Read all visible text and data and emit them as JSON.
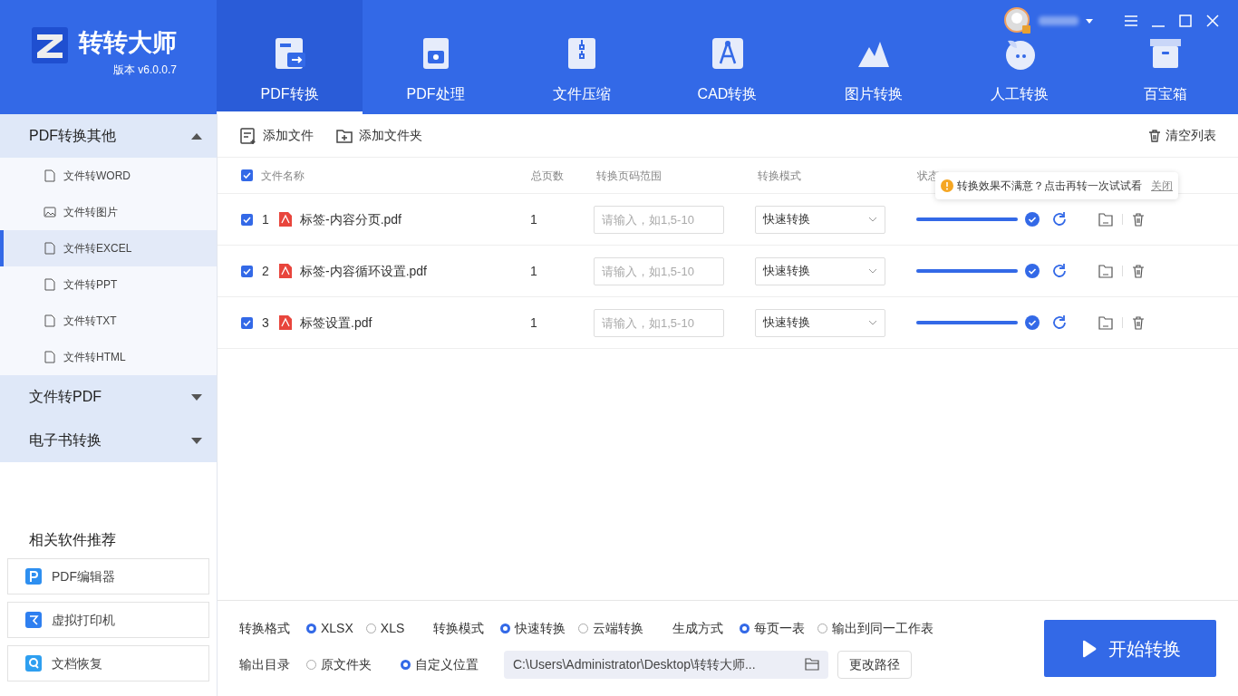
{
  "app": {
    "name": "转转大师",
    "version": "版本 v6.0.0.7"
  },
  "nav_tabs": [
    {
      "label": "PDF转换",
      "selected": true,
      "kind": "pdf"
    },
    {
      "label": "PDF处理",
      "selected": false,
      "kind": "process"
    },
    {
      "label": "文件压缩",
      "selected": false,
      "kind": "zip"
    },
    {
      "label": "CAD转换",
      "selected": false,
      "kind": "cad"
    },
    {
      "label": "图片转换",
      "selected": false,
      "kind": "image"
    },
    {
      "label": "人工转换",
      "selected": false,
      "kind": "chat"
    },
    {
      "label": "百宝箱",
      "selected": false,
      "kind": "box"
    }
  ],
  "sidebar": {
    "groups": [
      {
        "label": "PDF转换其他",
        "expanded": true,
        "items": [
          {
            "label": "文件转WORD",
            "selected": false,
            "kind": "document"
          },
          {
            "label": "文件转图片",
            "selected": false,
            "kind": "image"
          },
          {
            "label": "文件转EXCEL",
            "selected": true,
            "kind": "document"
          },
          {
            "label": "文件转PPT",
            "selected": false,
            "kind": "document"
          },
          {
            "label": "文件转TXT",
            "selected": false,
            "kind": "document"
          },
          {
            "label": "文件转HTML",
            "selected": false,
            "kind": "document"
          }
        ]
      },
      {
        "label": "文件转PDF",
        "expanded": false
      },
      {
        "label": "电子书转换",
        "expanded": false
      }
    ],
    "recommend": {
      "title": "相关软件推荐",
      "items": [
        {
          "label": "PDF编辑器",
          "kind": "editor"
        },
        {
          "label": "虚拟打印机",
          "kind": "printer"
        },
        {
          "label": "文档恢复",
          "kind": "recover"
        }
      ]
    }
  },
  "toolbar": {
    "add_file": "添加文件",
    "add_folder": "添加文件夹",
    "clear_list": "清空列表"
  },
  "table": {
    "all_checked": true,
    "columns": [
      "文件名称",
      "总页数",
      "转换页码范围",
      "转换模式",
      "状态"
    ],
    "rows": [
      {
        "checked": true,
        "index": "1",
        "name": "标签-内容分页.pdf",
        "pages": "1",
        "range_placeholder": "请输入，如1,5-10",
        "mode": "快速转换",
        "level": 1
      },
      {
        "checked": true,
        "index": "2",
        "name": "标签-内容循环设置.pdf",
        "pages": "1",
        "range_placeholder": "请输入，如1,5-10",
        "mode": "快速转换",
        "level": 1
      },
      {
        "checked": true,
        "index": "3",
        "name": "标签设置.pdf",
        "pages": "1",
        "range_placeholder": "请输入，如1,5-10",
        "mode": "快速转换",
        "level": 1
      }
    ]
  },
  "tooltip": {
    "text": "转换效果不满意？点击再转一次试试看",
    "close": "关闭"
  },
  "options": {
    "rows": [
      [
        {
          "label": "转换格式",
          "choices": [
            {
              "label": "XLSX",
              "selected": true
            },
            {
              "label": "XLS",
              "selected": false
            }
          ]
        },
        {
          "label": "转换模式",
          "choices": [
            {
              "label": "快速转换",
              "selected": true
            },
            {
              "label": "云端转换",
              "selected": false
            }
          ]
        },
        {
          "label": "生成方式",
          "choices": [
            {
              "label": "每页一表",
              "selected": true
            },
            {
              "label": "输出到同一工作表",
              "selected": false
            }
          ]
        }
      ],
      [
        {
          "label": "输出目录",
          "choices": [
            {
              "label": "原文件夹",
              "selected": false
            },
            {
              "label": "自定义位置",
              "selected": true
            }
          ]
        }
      ]
    ],
    "path": "C:\\Users\\Administrator\\Desktop\\转转大师...",
    "change_path": "更改路径"
  },
  "start_button": "开始转换"
}
